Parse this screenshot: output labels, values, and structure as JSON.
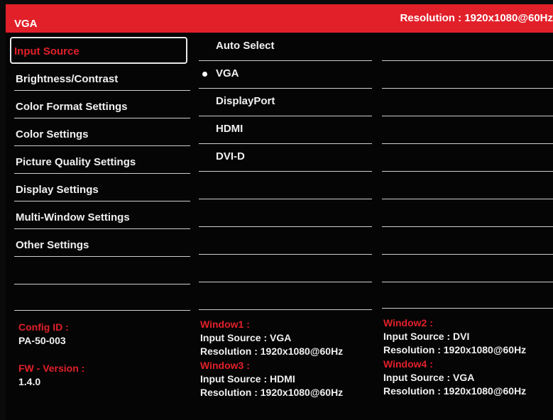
{
  "header": {
    "title": "VGA",
    "resolution": "Resolution : 1920x1080@60Hz"
  },
  "menu": {
    "items": [
      {
        "label": "Input Source"
      },
      {
        "label": "Brightness/Contrast"
      },
      {
        "label": "Color Format Settings"
      },
      {
        "label": "Color Settings"
      },
      {
        "label": "Picture Quality Settings"
      },
      {
        "label": "Display Settings"
      },
      {
        "label": "Multi-Window Settings"
      },
      {
        "label": "Other Settings"
      }
    ]
  },
  "input_options": {
    "items": [
      {
        "label": "Auto Select"
      },
      {
        "label": "VGA"
      },
      {
        "label": "DisplayPort"
      },
      {
        "label": "HDMI"
      },
      {
        "label": "DVI-D"
      }
    ]
  },
  "info": {
    "config_id_label": "Config ID :",
    "config_id_value": "PA-50-003",
    "fw_label": "FW - Version :",
    "fw_value": "1.4.0"
  },
  "windows": {
    "w1": {
      "title": "Window1 :",
      "input": "Input Source : VGA",
      "resolution": "Resolution : 1920x1080@60Hz"
    },
    "w2": {
      "title": "Window2 :",
      "input": "Input Source :   DVI",
      "resolution": "Resolution : 1920x1080@60Hz"
    },
    "w3": {
      "title": "Window3 :",
      "input": "Input Source :   HDMI",
      "resolution": "Resolution : 1920x1080@60Hz"
    },
    "w4": {
      "title": "Window4 :",
      "input": "Input Source : VGA",
      "resolution": "Resolution : 1920x1080@60Hz"
    }
  },
  "colors": {
    "accent": "#e2202a",
    "background": "#050505",
    "text": "#f0f0f0"
  }
}
